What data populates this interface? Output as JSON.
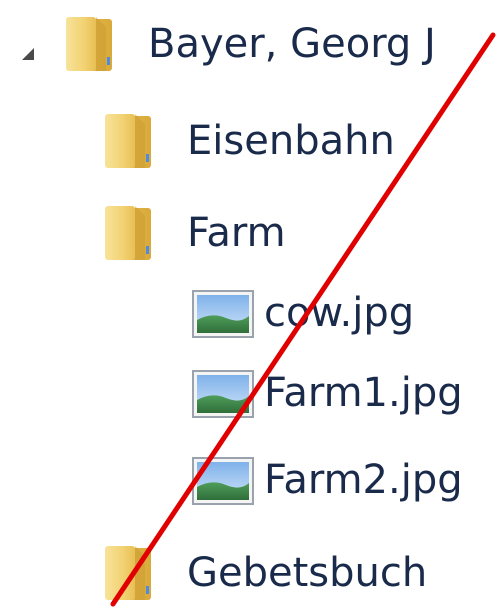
{
  "tree": {
    "root": {
      "label": "Bayer, Georg J",
      "expanded": true,
      "icon": "folder-icon",
      "children": [
        {
          "label": "Eisenbahn",
          "type": "folder",
          "icon": "folder-icon"
        },
        {
          "label": "Farm",
          "type": "folder",
          "icon": "folder-icon",
          "children": [
            {
              "label": "cow.jpg",
              "type": "image",
              "icon": "image-file-icon"
            },
            {
              "label": "Farm1.jpg",
              "type": "image",
              "icon": "image-file-icon"
            },
            {
              "label": "Farm2.jpg",
              "type": "image",
              "icon": "image-file-icon"
            }
          ]
        },
        {
          "label": "Gebetsbuch",
          "type": "folder",
          "icon": "folder-icon"
        }
      ]
    }
  },
  "colors": {
    "folder_front": "#f3d67a",
    "folder_back": "#e3b84e",
    "folder_shadow": "#c99a2e",
    "text": "#1a2a4a",
    "annotation_line": "#e00000",
    "image_sky": "#5b8fd6",
    "image_ground": "#3f8a4a"
  }
}
